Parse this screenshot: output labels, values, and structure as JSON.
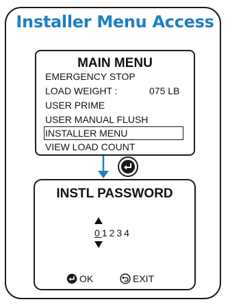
{
  "page": {
    "title": "Installer Menu Access"
  },
  "main_menu": {
    "title": "MAIN MENU",
    "items": [
      {
        "label": "EMERGENCY STOP"
      },
      {
        "label": "LOAD WEIGHT :",
        "value": "075 LB"
      },
      {
        "label": "USER PRIME"
      },
      {
        "label": "USER MANUAL FLUSH"
      },
      {
        "label": "INSTALLER MENU",
        "selected": true
      },
      {
        "label": "VIEW LOAD COUNT"
      }
    ]
  },
  "navigation": {
    "arrow_icon": "arrow-down-icon",
    "enter_icon": "enter-icon",
    "arrow_color": "#1e7fc1"
  },
  "password_screen": {
    "title": "INSTL PASSWORD",
    "digit_active": "0",
    "digits_rest": "1234",
    "up_icon": "triangle-up-icon",
    "down_icon": "triangle-down-icon",
    "ok_label": "OK",
    "exit_label": "EXIT",
    "ok_icon": "enter-icon",
    "exit_icon": "back-icon"
  },
  "colors": {
    "accent": "#1e7fc1",
    "text": "#111111",
    "border": "#1a1a1a"
  }
}
